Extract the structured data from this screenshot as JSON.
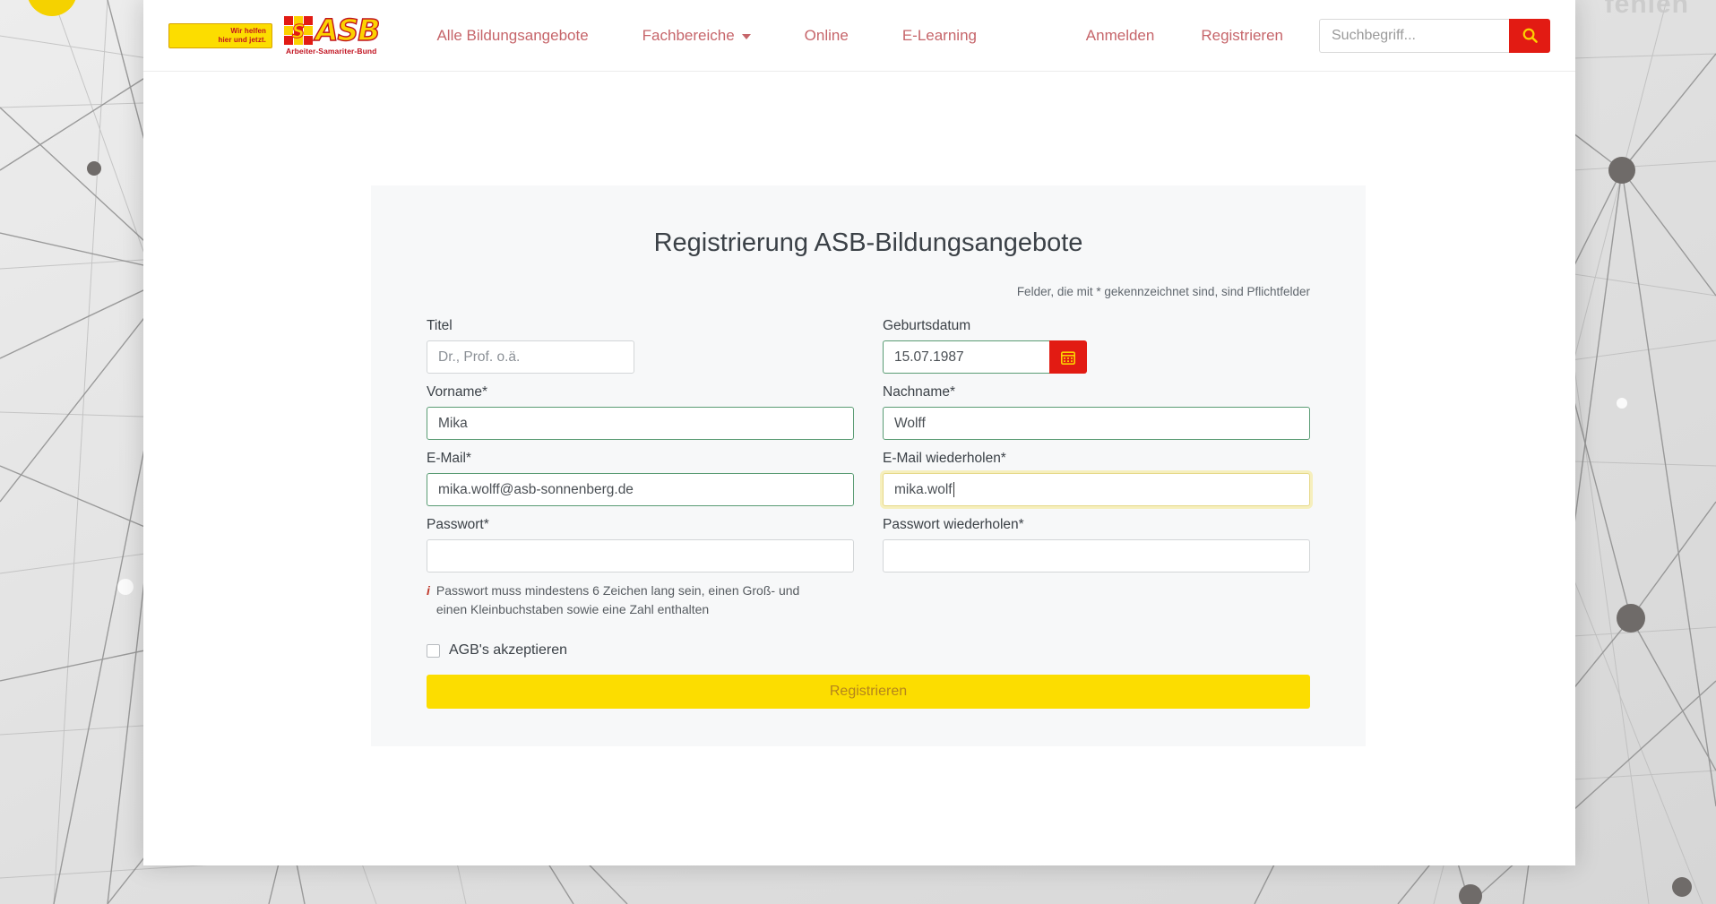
{
  "background": {
    "corner_text": "fehlen"
  },
  "header": {
    "logo": {
      "claim_line1": "Wir helfen",
      "claim_line2": "hier und jetzt.",
      "wordmark": "ASB",
      "subtitle": "Arbeiter-Samariter-Bund",
      "cross_icon": "asb-cross-icon"
    },
    "nav": [
      {
        "label": "Alle Bildungsangebote",
        "has_caret": false
      },
      {
        "label": "Fachbereiche",
        "has_caret": true
      },
      {
        "label": "Online",
        "has_caret": false
      },
      {
        "label": "E-Learning",
        "has_caret": false
      }
    ],
    "right_nav": [
      {
        "label": "Anmelden"
      },
      {
        "label": "Registrieren"
      }
    ],
    "search": {
      "placeholder": "Suchbegriff...",
      "value": "",
      "button_icon": "search-icon"
    }
  },
  "form": {
    "title": "Registrierung ASB-Bildungsangebote",
    "required_note": "Felder, die mit * gekennzeichnet sind, sind Pflichtfelder",
    "fields": {
      "titel": {
        "label": "Titel",
        "placeholder": "Dr., Prof. o.ä.",
        "value": ""
      },
      "geburtsdatum": {
        "label": "Geburtsdatum",
        "value": "15.07.1987",
        "placeholder": "",
        "button_icon": "calendar-icon"
      },
      "vorname": {
        "label": "Vorname*",
        "value": "Mika",
        "placeholder": ""
      },
      "nachname": {
        "label": "Nachname*",
        "value": "Wolff",
        "placeholder": ""
      },
      "email": {
        "label": "E-Mail*",
        "value": "mika.wolff@asb-sonnenberg.de",
        "placeholder": ""
      },
      "email_repeat": {
        "label": "E-Mail wiederholen*",
        "value": "mika.wolf",
        "placeholder": ""
      },
      "passwort": {
        "label": "Passwort*",
        "value": "",
        "placeholder": ""
      },
      "passwort_repeat": {
        "label": "Passwort wiederholen*",
        "value": "",
        "placeholder": ""
      }
    },
    "password_hint": {
      "icon": "info-icon",
      "icon_glyph": "i",
      "text": "Passwort muss mindestens 6 Zeichen lang sein, einen Groß- und einen Kleinbuchstaben sowie eine Zahl enthalten"
    },
    "agb": {
      "label": "AGB's akzeptieren",
      "checked": false
    },
    "submit_label": "Registrieren"
  },
  "colors": {
    "brand_red": "#e21b13",
    "brand_yellow": "#fcdd00",
    "nav_link": "#c6656a",
    "valid_border": "#5a9c74",
    "focus_border": "#e6d98a",
    "panel_bg": "#f7f8f9"
  }
}
